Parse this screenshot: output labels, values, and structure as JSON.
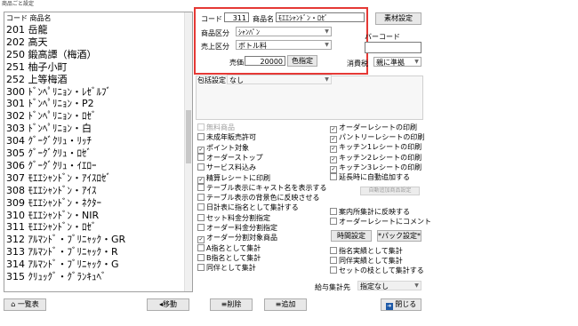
{
  "window": {
    "title": "商品ごと設定"
  },
  "list": {
    "header": "コード 商品名",
    "items": [
      "201 岳龍",
      "202 高天",
      "250 鍛高譚（梅酒）",
      "251 柚子小町",
      "252 上等梅酒",
      "300 ﾄﾞﾝﾍﾟﾘﾆｮﾝ・ﾚｾﾞﾙﾌﾞ",
      "301 ﾄﾞﾝﾍﾟﾘﾆｮﾝ・P2",
      "302 ﾄﾞﾝﾍﾟﾘﾆｮﾝ・ﾛｾﾞ",
      "303 ﾄﾞﾝﾍﾟﾘﾆｮﾝ・白",
      "304 ｸﾞｰｸﾞｸﾘｭ・ﾘｯﾁ",
      "305 ｸﾞｰｸﾞｸﾘｭ・ﾛｾﾞ",
      "306 ｸﾞｰｸﾞｸﾘｭ・ｲｴﾛｰ",
      "307 ﾓｴｴｼｬﾝﾄﾞﾝ・ｱｲｽﾛｾﾞ",
      "308 ﾓｴｴｼｬﾝﾄﾞﾝ・ｱｲｽ",
      "309 ﾓｴｴｼｬﾝﾄﾞﾝ・ﾈｸﾀｰ",
      "310 ﾓｴｴｼｬﾝﾄﾞﾝ・NIR",
      "311 ﾓｴｴｼｬﾝﾄﾞﾝ・ﾛｾﾞ",
      "312 ｱﾙﾏﾝﾄﾞ・ﾌﾞﾘﾆｬｯｸ・GR",
      "313 ｱﾙﾏﾝﾄﾞ・ﾌﾞﾘﾆｬｯｸ・R",
      "314 ｱﾙﾏﾝﾄﾞ・ﾌﾞﾘﾆｬｯｸ・G",
      "315 ｸﾘｭｯｸﾞ・ｸﾞﾗﾝｷｭﾍﾞ"
    ]
  },
  "form": {
    "code_label": "コード",
    "code_value": "311",
    "name_label": "商品名",
    "name_value": "ﾓｴｴｼｬﾝﾄﾞﾝ・ﾛｾﾞ",
    "category_label": "商品区分",
    "category_value": "ｼｬﾝﾊﾟﾝ",
    "sales_label": "売上区分",
    "sales_value": "ボトル料",
    "price_label": "売価",
    "price_value": "20000",
    "color_button": "色指定",
    "material_button": "素材設定",
    "barcode_label": "バーコード",
    "barcode_value": "",
    "tax_label": "消費税",
    "tax_value": "親に準拠",
    "info_label": "包括設定",
    "info_value": "なし"
  },
  "checks_left": [
    {
      "label": "無料商品",
      "checked": false,
      "disabled": true
    },
    {
      "label": "未成年販売許可",
      "checked": false,
      "disabled": false
    },
    {
      "label": "ポイント対象",
      "checked": true,
      "disabled": false
    },
    {
      "label": "オーダーストップ",
      "checked": false,
      "disabled": false
    },
    {
      "label": "サービス料込み",
      "checked": false,
      "disabled": false
    },
    {
      "label": "精算レシートに印刷",
      "checked": true,
      "disabled": false
    },
    {
      "label": "テーブル表示にキャスト名を表示する",
      "checked": false,
      "disabled": false
    },
    {
      "label": "テーブル表示の背景色に反映させる",
      "checked": false,
      "disabled": false
    },
    {
      "label": "日計表に指名として集計する",
      "checked": false,
      "disabled": false
    },
    {
      "label": "セット料金分割指定",
      "checked": false,
      "disabled": false
    },
    {
      "label": "オーダー料金分割指定",
      "checked": false,
      "disabled": false
    },
    {
      "label": "オーダー分割対象商品",
      "checked": true,
      "disabled": false
    },
    {
      "label": "A指名として集計",
      "checked": false,
      "disabled": false
    },
    {
      "label": "B指名として集計",
      "checked": false,
      "disabled": false
    },
    {
      "label": "同伴として集計",
      "checked": false,
      "disabled": false
    }
  ],
  "checks_right_top": [
    {
      "label": "オーダーレシートの印刷",
      "checked": true
    },
    {
      "label": "パントリーレシートの印刷",
      "checked": true
    },
    {
      "label": "キッチン1レシートの印刷",
      "checked": true
    },
    {
      "label": "キッチン2レシートの印刷",
      "checked": true
    },
    {
      "label": "キッチン3レシートの印刷",
      "checked": true
    },
    {
      "label": "延長時に自動追加する",
      "checked": false
    }
  ],
  "checks_right_mid": [
    {
      "label": "案内所集計に反映する",
      "checked": false
    },
    {
      "label": "オーダーレシートにコメント",
      "checked": false
    }
  ],
  "checks_right_bottom": [
    {
      "label": "指名実績として集計",
      "checked": false
    },
    {
      "label": "同伴実績として集計",
      "checked": false
    },
    {
      "label": "セットの枝として集計する",
      "checked": false
    }
  ],
  "auto_add_button": "自動追加商品設定",
  "time_button": "時間設定",
  "pack_button": "*パック設定*",
  "salary_label": "給与集計先",
  "salary_value": "指定なし",
  "bottom": {
    "list_button": "一覧表",
    "move_button": "移動",
    "delete_button": "削除",
    "add_button": "追加",
    "close_button": "閉じる"
  },
  "colors": {
    "highlight": "#e53935",
    "close_icon": "#1e5aa8"
  }
}
